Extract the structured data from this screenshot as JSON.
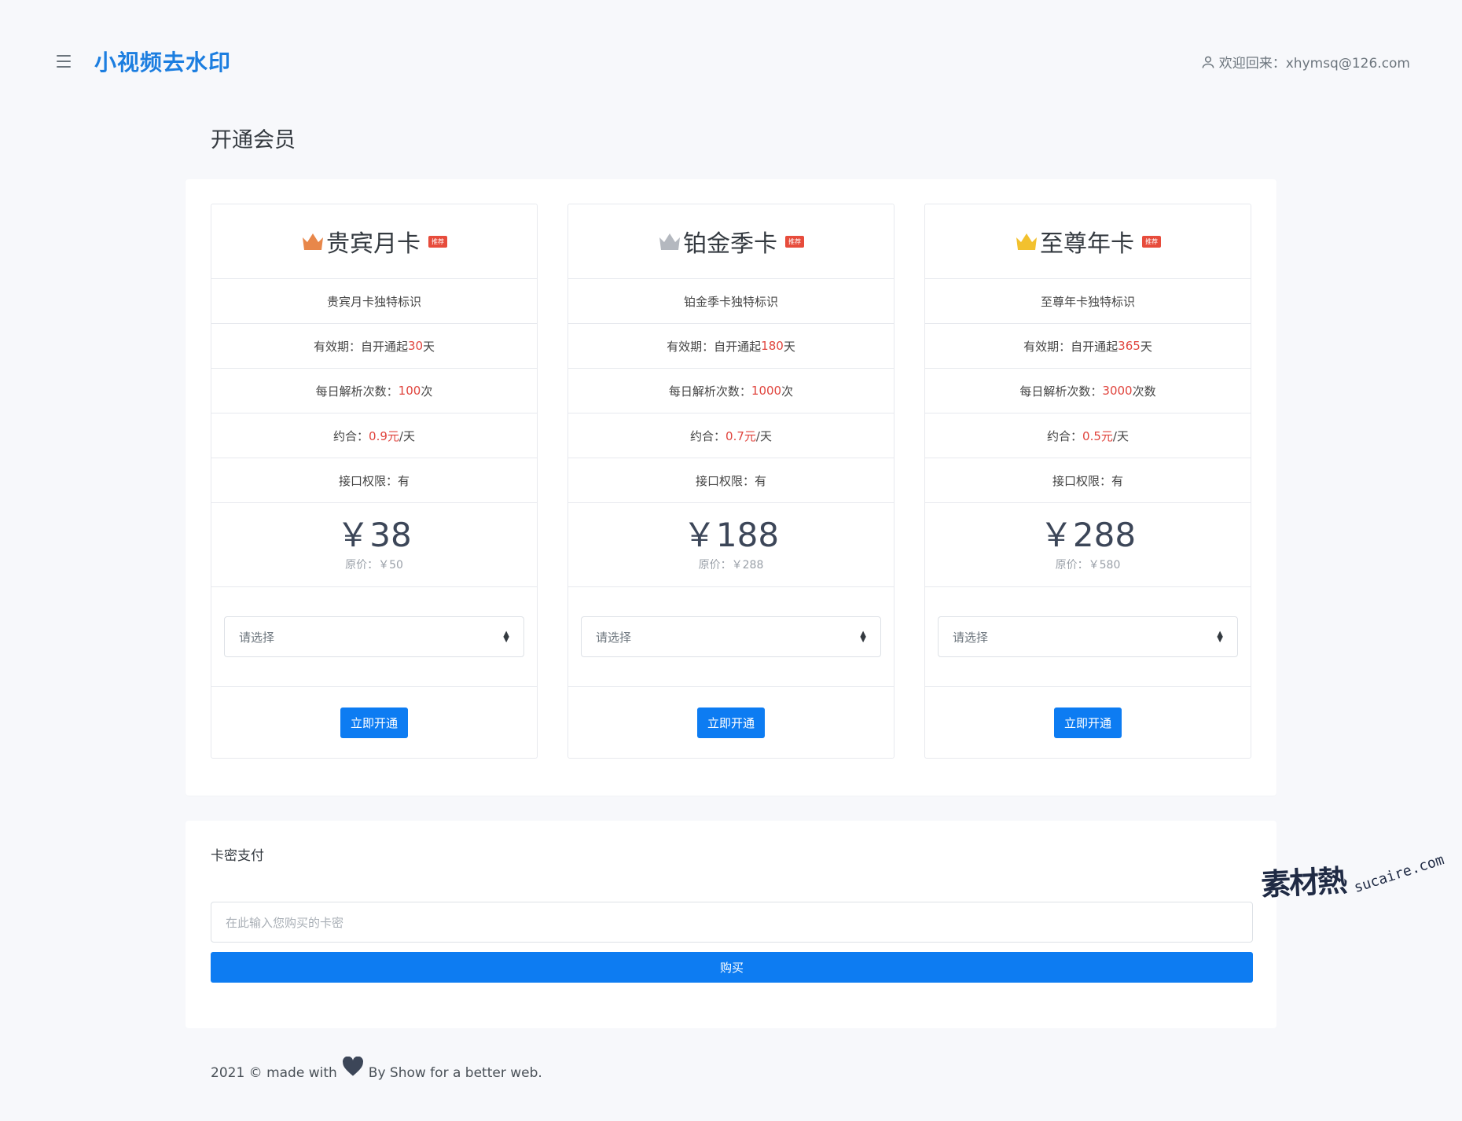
{
  "header": {
    "brand": "小视频去水印",
    "welcome": "欢迎回来：xhymsq@126.com"
  },
  "page_title": "开通会员",
  "plans": [
    {
      "name": "贵宾月卡",
      "badge": "推荐",
      "crown_color": "#e8874a",
      "feature": "贵宾月卡独特标识",
      "validity_prefix": "有效期：自开通起",
      "validity_value": "30",
      "validity_suffix": "天",
      "daily_prefix": "每日解析次数：",
      "daily_value": "100",
      "daily_suffix": "次",
      "avg_prefix": "约合：",
      "avg_value": "0.9元",
      "avg_suffix": "/天",
      "api": "接口权限：有",
      "price": "￥38",
      "original": "原价：￥50",
      "select_placeholder": "请选择",
      "button": "立即开通"
    },
    {
      "name": "铂金季卡",
      "badge": "推荐",
      "crown_color": "#b4b8bf",
      "feature": "铂金季卡独特标识",
      "validity_prefix": "有效期：自开通起",
      "validity_value": "180",
      "validity_suffix": "天",
      "daily_prefix": "每日解析次数：",
      "daily_value": "1000",
      "daily_suffix": "次",
      "avg_prefix": "约合：",
      "avg_value": "0.7元",
      "avg_suffix": "/天",
      "api": "接口权限：有",
      "price": "￥188",
      "original": "原价：￥288",
      "select_placeholder": "请选择",
      "button": "立即开通"
    },
    {
      "name": "至尊年卡",
      "badge": "推荐",
      "crown_color": "#f2c12e",
      "feature": "至尊年卡独特标识",
      "validity_prefix": "有效期：自开通起",
      "validity_value": "365",
      "validity_suffix": "天",
      "daily_prefix": "每日解析次数：",
      "daily_value": "3000",
      "daily_suffix": " 次数",
      "avg_prefix": "约合：",
      "avg_value": "0.5元",
      "avg_suffix": "/天",
      "api": "接口权限：有",
      "price": "￥288",
      "original": "原价：￥580",
      "select_placeholder": "请选择",
      "button": "立即开通"
    }
  ],
  "card_pay": {
    "title": "卡密支付",
    "placeholder": "在此输入您购买的卡密",
    "button": "购买"
  },
  "footer": {
    "left": "2021 © made with",
    "right": "By Show for a better web."
  },
  "watermark": {
    "cn": "素材熱",
    "en": "sucaire.com"
  }
}
